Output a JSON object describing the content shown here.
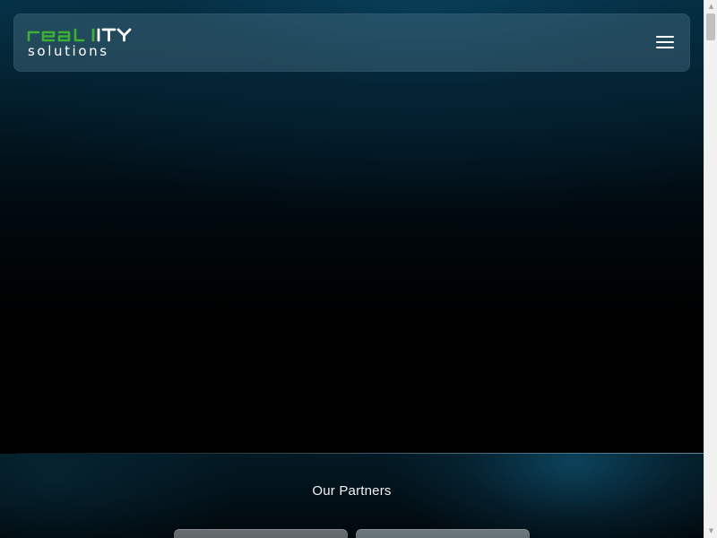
{
  "brand": {
    "logo_top": "REALITY",
    "logo_bottom": "solutions",
    "logo_green": "#3cb034",
    "logo_white": "#ffffff"
  },
  "navbar": {
    "menu_icon": "hamburger-menu-icon"
  },
  "partners": {
    "title": "Our Partners",
    "cards": [
      {
        "name": ""
      },
      {
        "name": ""
      }
    ]
  },
  "scrollbar": {
    "up_icon": "triangle-up-icon",
    "down_icon": "triangle-down-icon"
  },
  "colors": {
    "hero_top": "#06354b",
    "background": "#000000",
    "accent_green": "#3cb034"
  }
}
